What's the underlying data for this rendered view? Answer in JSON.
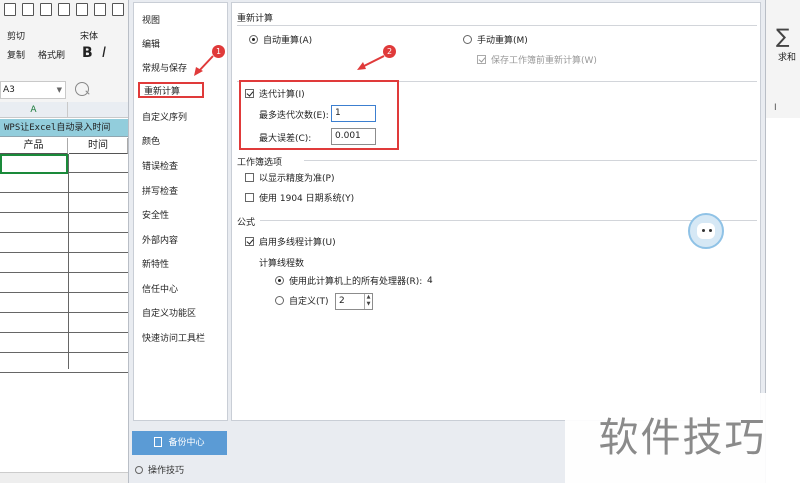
{
  "spreadsheet": {
    "ribbon": {
      "cut_label": "剪切",
      "copy_label": "复制",
      "format_painter_label": "格式刷",
      "font_name": "宋体",
      "bold_label": "B",
      "italic_label": "I"
    },
    "name_box": "A3",
    "column_a": "A",
    "title_row": "WPS让Excel自动录入时间",
    "headers": [
      "产品",
      "时间"
    ],
    "right_side": {
      "sum_label": "求和",
      "column_i": "I"
    }
  },
  "dialog": {
    "nav_items": [
      "视图",
      "编辑",
      "常规与保存",
      "重新计算",
      "自定义序列",
      "颜色",
      "错误检查",
      "拼写检查",
      "安全性",
      "外部内容",
      "新特性",
      "信任中心",
      "自定义功能区",
      "快速访问工具栏"
    ],
    "selected_nav": "重新计算",
    "backup_label": "备份中心",
    "tips_label": "操作技巧",
    "sections": {
      "recalc": {
        "title": "重新计算",
        "auto_label": "自动重算(A)",
        "manual_label": "手动重算(M)",
        "save_before_label": "保存工作簿前重新计算(W)",
        "iteration_label": "迭代计算(I)",
        "max_iter_label": "最多迭代次数(E):",
        "max_iter_value": "1",
        "max_change_label": "最大误差(C):",
        "max_change_value": "0.001"
      },
      "workbook": {
        "title": "工作簿选项",
        "precision_label": "以显示精度为准(P)",
        "date1904_label": "使用 1904 日期系统(Y)"
      },
      "formula": {
        "title": "公式",
        "multithread_label": "启用多线程计算(U)",
        "threads_label": "计算线程数",
        "use_all_label": "使用此计算机上的所有处理器(R):",
        "processor_count": "4",
        "custom_label": "自定义(T)",
        "custom_value": "2"
      }
    }
  },
  "annotations": {
    "marker1": "1",
    "marker2": "2",
    "accent_color": "#e03a3a"
  },
  "watermark": "软件技巧"
}
